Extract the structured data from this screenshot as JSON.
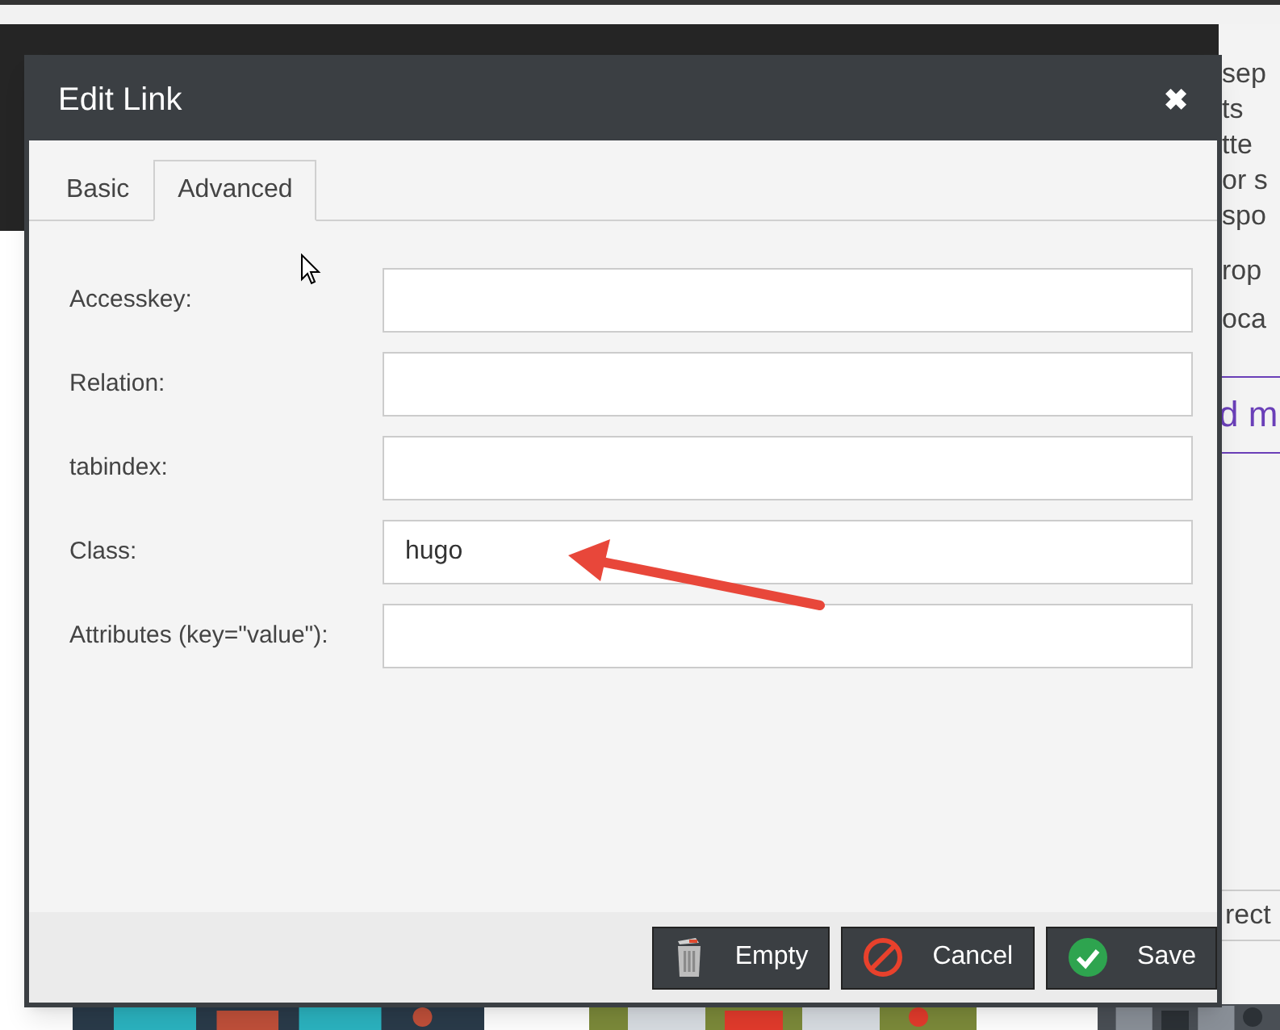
{
  "background_fragments": [
    {
      "text": "sep",
      "kind": "plain"
    },
    {
      "text": "ts",
      "kind": "plain"
    },
    {
      "text": "tte",
      "kind": "plain"
    },
    {
      "text": "or s",
      "kind": "plain"
    },
    {
      "text": "spo",
      "kind": "plain"
    },
    {
      "text": "rop",
      "kind": "plain"
    },
    {
      "text": "oca",
      "kind": "plain"
    },
    {
      "text": "d m",
      "kind": "link"
    },
    {
      "text": "rect",
      "kind": "plain"
    }
  ],
  "dialog": {
    "title": "Edit Link",
    "close": "✖",
    "tabs": [
      {
        "label": "Basic",
        "selected": false
      },
      {
        "label": "Advanced",
        "selected": true
      }
    ],
    "fields": [
      {
        "label": "Accesskey:"
      },
      {
        "label": "Relation:"
      },
      {
        "label": "tabindex:"
      },
      {
        "label": "Class:",
        "value": "hugo"
      },
      {
        "label": "Attributes (key=\"value\"):"
      }
    ],
    "buttons": [
      {
        "label": "Empty",
        "kind": "empty"
      },
      {
        "label": "Cancel",
        "kind": "cancel"
      },
      {
        "label": "Save",
        "kind": "save"
      }
    ]
  }
}
